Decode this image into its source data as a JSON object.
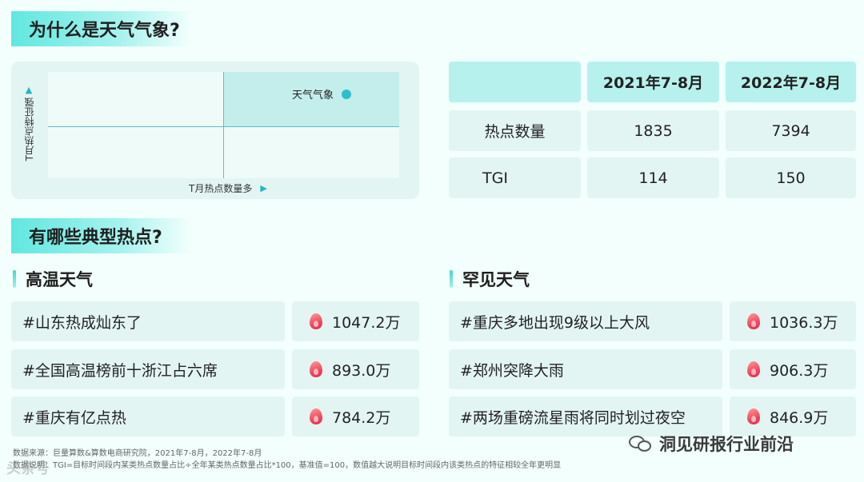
{
  "section1": {
    "title": "为什么是天气气象?"
  },
  "quadrant": {
    "highlight_label": "天气气象",
    "x_axis_label": "T月热点数量多",
    "y_axis_label": "T月热点特征强",
    "accent_color": "#2cc0cc"
  },
  "table": {
    "headers": [
      "",
      "2021年7-8月",
      "2022年7-8月"
    ],
    "rows": [
      {
        "label": "热点数量",
        "v2021": "1835",
        "v2022": "7394"
      },
      {
        "label": "TGI",
        "v2021": "114",
        "v2022": "150"
      }
    ]
  },
  "section2": {
    "title": "有哪些典型热点?"
  },
  "groups": [
    {
      "title": "高温天气",
      "items": [
        {
          "topic": "#山东热成灿东了",
          "heat": "1047.2万"
        },
        {
          "topic": "#全国高温榜前十浙江占六席",
          "heat": "893.0万"
        },
        {
          "topic": "#重庆有亿点热",
          "heat": "784.2万"
        }
      ]
    },
    {
      "title": "罕见天气",
      "items": [
        {
          "topic": "#重庆多地出现9级以上大风",
          "heat": "1036.3万"
        },
        {
          "topic": "#郑州突降大雨",
          "heat": "906.3万"
        },
        {
          "topic": "#两场重磅流星雨将同时划过夜空",
          "heat": "846.9万"
        }
      ]
    }
  ],
  "footnotes": {
    "source": "数据来源：巨量算数&算数电商研究院，2021年7-8月，2022年7-8月",
    "note": "数据说明：TGI=目标时间段内某类热点数量占比÷全年某类热点数量占比*100，基准值=100，数值越大说明目标时间段内该类热点的特征相较全年更明显"
  },
  "watermark": {
    "left": "头条号",
    "right": "洞见研报行业前沿"
  }
}
